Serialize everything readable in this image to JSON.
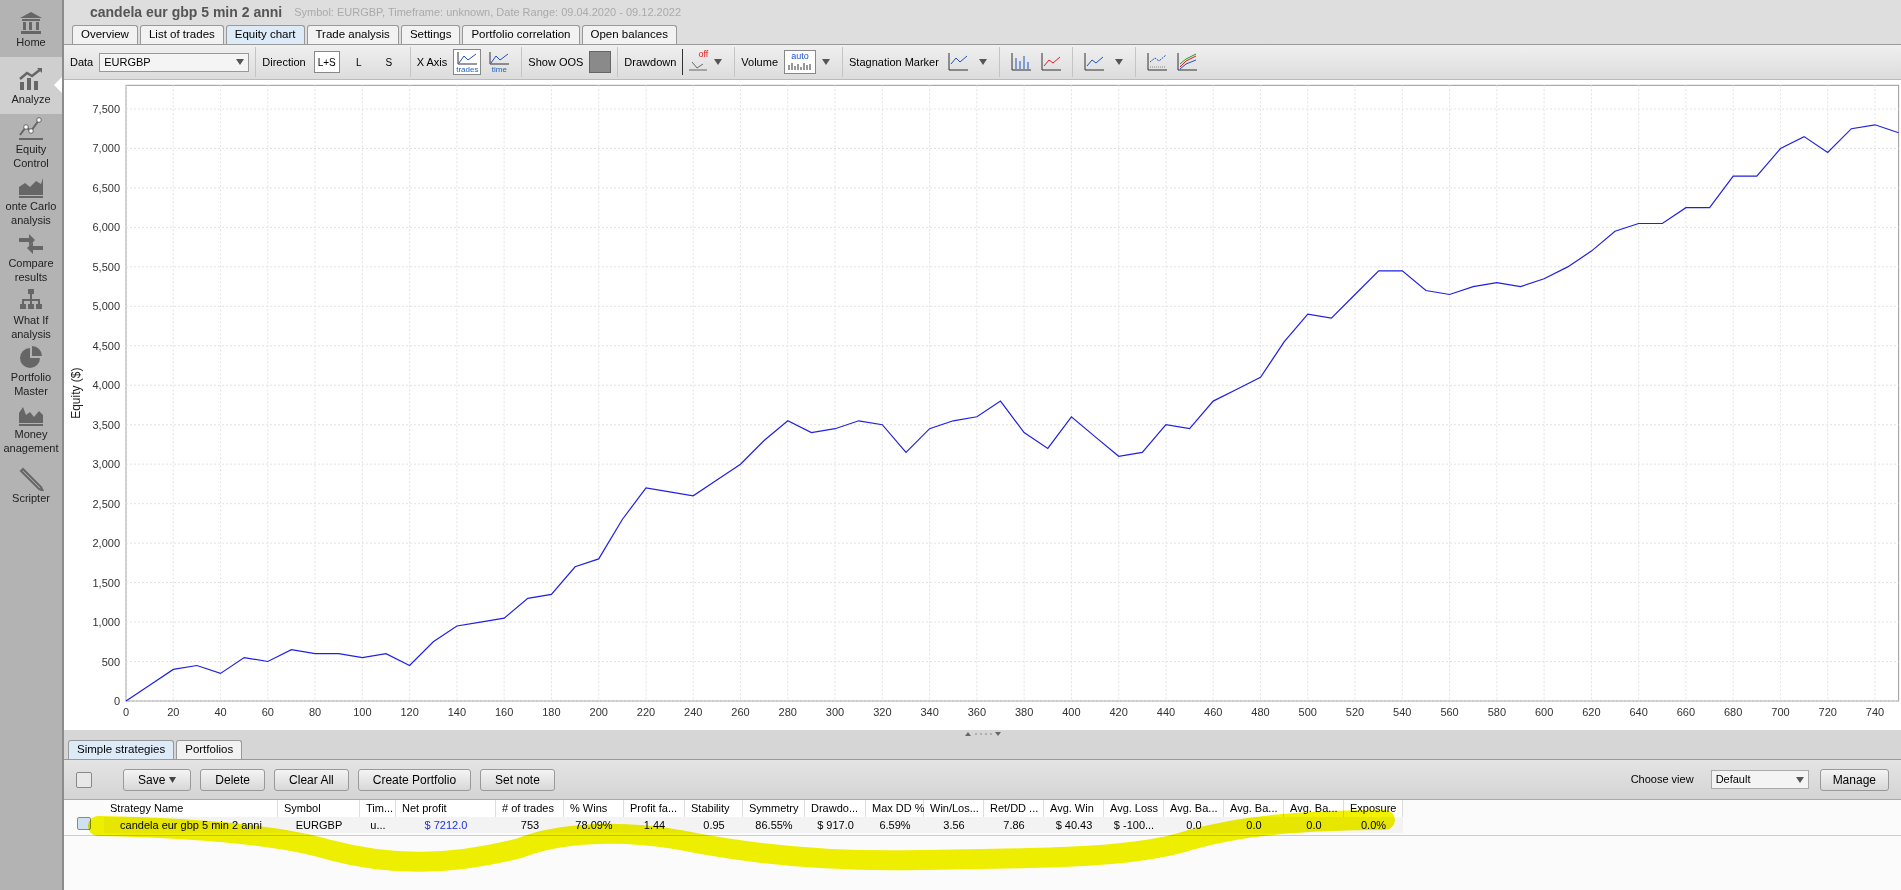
{
  "title": "candela eur gbp 5 min 2 anni",
  "subtitle": "Symbol: EURGBP, Timeframe: unknown, Date Range: 09.04.2020 - 09.12.2022",
  "sidebar": {
    "items": [
      {
        "kind": "home",
        "lines": [
          "Home"
        ],
        "selected": false
      },
      {
        "kind": "analyze",
        "lines": [
          "Analyze"
        ],
        "selected": true
      },
      {
        "kind": "equity",
        "lines": [
          "Equity",
          "Control"
        ],
        "selected": false
      },
      {
        "kind": "montecarlo",
        "lines": [
          "onte Carlo",
          "analysis"
        ],
        "selected": false
      },
      {
        "kind": "compare",
        "lines": [
          "Compare",
          "results"
        ],
        "selected": false
      },
      {
        "kind": "whatif",
        "lines": [
          "What If",
          "analysis"
        ],
        "selected": false
      },
      {
        "kind": "portfolio",
        "lines": [
          "Portfolio",
          "Master"
        ],
        "selected": false
      },
      {
        "kind": "money",
        "lines": [
          "Money",
          "anagement"
        ],
        "selected": false
      },
      {
        "kind": "scripter",
        "lines": [
          "Scripter"
        ],
        "selected": false
      }
    ]
  },
  "tabs": [
    {
      "label": "Overview",
      "selected": false
    },
    {
      "label": "List of trades",
      "selected": false
    },
    {
      "label": "Equity chart",
      "selected": true
    },
    {
      "label": "Trade analysis",
      "selected": false
    },
    {
      "label": "Settings",
      "selected": false
    },
    {
      "label": "Portfolio correlation",
      "selected": false
    },
    {
      "label": "Open balances",
      "selected": false
    }
  ],
  "toolbar": {
    "data_label": "Data",
    "data_value": "EURGBP",
    "direction_label": "Direction",
    "direction_options": [
      {
        "label": "L+S",
        "selected": true
      },
      {
        "label": "L",
        "selected": false
      },
      {
        "label": "S",
        "selected": false
      }
    ],
    "xaxis_label": "X Axis",
    "xaxis_options": [
      {
        "label": "trades",
        "selected": true
      },
      {
        "label": "time",
        "selected": false
      }
    ],
    "show_oos_label": "Show OOS",
    "drawdown_label": "Drawdown",
    "drawdown_badge": "off",
    "volume_label": "Volume",
    "volume_badge": "auto",
    "stagnation_label": "Stagnation Marker"
  },
  "chart": {
    "chart_data": {
      "type": "line",
      "ylabel": "Equity ($)",
      "xlim": [
        0,
        750
      ],
      "ylim": [
        0,
        7800
      ],
      "x": [
        0,
        10,
        20,
        30,
        40,
        50,
        60,
        70,
        80,
        90,
        100,
        110,
        120,
        130,
        140,
        150,
        160,
        170,
        180,
        190,
        200,
        210,
        220,
        230,
        240,
        250,
        260,
        270,
        280,
        290,
        300,
        310,
        320,
        330,
        340,
        350,
        360,
        370,
        380,
        390,
        400,
        410,
        420,
        430,
        440,
        450,
        460,
        470,
        480,
        490,
        500,
        510,
        520,
        530,
        540,
        550,
        560,
        570,
        580,
        590,
        600,
        610,
        620,
        630,
        640,
        650,
        660,
        670,
        680,
        690,
        700,
        710,
        720,
        730,
        740,
        750
      ],
      "grid": true,
      "series": [
        {
          "color": "#2020e0",
          "values": [
            0,
            200,
            400,
            450,
            350,
            550,
            500,
            650,
            600,
            600,
            550,
            600,
            450,
            750,
            950,
            1000,
            1050,
            1300,
            1350,
            1700,
            1800,
            2300,
            2700,
            2650,
            2600,
            2800,
            3000,
            3300,
            3550,
            3400,
            3450,
            3550,
            3500,
            3150,
            3450,
            3550,
            3600,
            3800,
            3400,
            3200,
            3600,
            3350,
            3100,
            3150,
            3500,
            3450,
            3800,
            3950,
            4100,
            4550,
            4900,
            4850,
            5150,
            5450,
            5450,
            5200,
            5150,
            5250,
            5300,
            5250,
            5350,
            5500,
            5700,
            5950,
            6050,
            6050,
            6250,
            6250,
            6650,
            6650,
            7000,
            7150,
            6950,
            7250,
            7300,
            7200
          ]
        }
      ],
      "xticks": [
        0,
        20,
        40,
        60,
        80,
        100,
        120,
        140,
        160,
        180,
        200,
        220,
        240,
        260,
        280,
        300,
        320,
        340,
        360,
        380,
        400,
        420,
        440,
        460,
        480,
        500,
        520,
        540,
        560,
        580,
        600,
        620,
        640,
        660,
        680,
        700,
        720,
        740
      ],
      "yticks": [
        0,
        {
          "value": 500,
          "label": "500"
        },
        {
          "value": 1000,
          "label": "1,000"
        },
        {
          "value": 1500,
          "label": "1,500"
        },
        {
          "value": 2000,
          "label": "2,000"
        },
        {
          "value": 2500,
          "label": "2,500"
        },
        {
          "value": 3000,
          "label": "3,000"
        },
        {
          "value": 3500,
          "label": "3,500"
        },
        {
          "value": 4000,
          "label": "4,000"
        },
        {
          "value": 4500,
          "label": "4,500"
        },
        {
          "value": 5000,
          "label": "5,000"
        },
        {
          "value": 5500,
          "label": "5,500"
        },
        {
          "value": 6000,
          "label": "6,000"
        },
        {
          "value": 6500,
          "label": "6,500"
        },
        {
          "value": 7000,
          "label": "7,000"
        },
        {
          "value": 7500,
          "label": "7,500"
        }
      ]
    }
  },
  "bottom_tabs": [
    {
      "label": "Simple strategies",
      "selected": true
    },
    {
      "label": "Portfolios",
      "selected": false
    }
  ],
  "buttons": [
    {
      "label": "Save",
      "kind": "menu"
    },
    {
      "label": "Delete",
      "kind": "plain"
    },
    {
      "label": "Clear All",
      "kind": "plain"
    },
    {
      "label": "Create Portfolio",
      "kind": "plain"
    },
    {
      "label": "Set note",
      "kind": "plain"
    }
  ],
  "select_all_checked": false,
  "choose_view": {
    "label": "Choose view",
    "value": "Default"
  },
  "manage_button": "Manage",
  "table": {
    "columns": [
      "Strategy Name",
      "Symbol",
      "Tim...",
      "Net profit",
      "# of trades",
      "% Wins",
      "Profit fa...",
      "Stability",
      "Symmetry",
      "Drawdo...",
      "Max DD %",
      "Win/Los...",
      "Ret/DD ...",
      "Avg. Win",
      "Avg. Loss",
      "Avg. Ba...",
      "Avg. Ba...",
      "Avg. Ba...",
      "Exposure"
    ],
    "rows": [
      {
        "checked": false,
        "cells": [
          "candela eur gbp 5 min 2 anni",
          "EURGBP",
          "u...",
          "$ 7212.0",
          "753",
          "78.09%",
          "1.44",
          "0.95",
          "86.55%",
          "$ 917.0",
          "6.59%",
          "3.56",
          "7.86",
          "$ 40.43",
          "$ -100...",
          "0.0",
          "0.0",
          "0.0",
          "0.0%"
        ]
      }
    ]
  },
  "annotation": {
    "kind": "highlighter"
  }
}
